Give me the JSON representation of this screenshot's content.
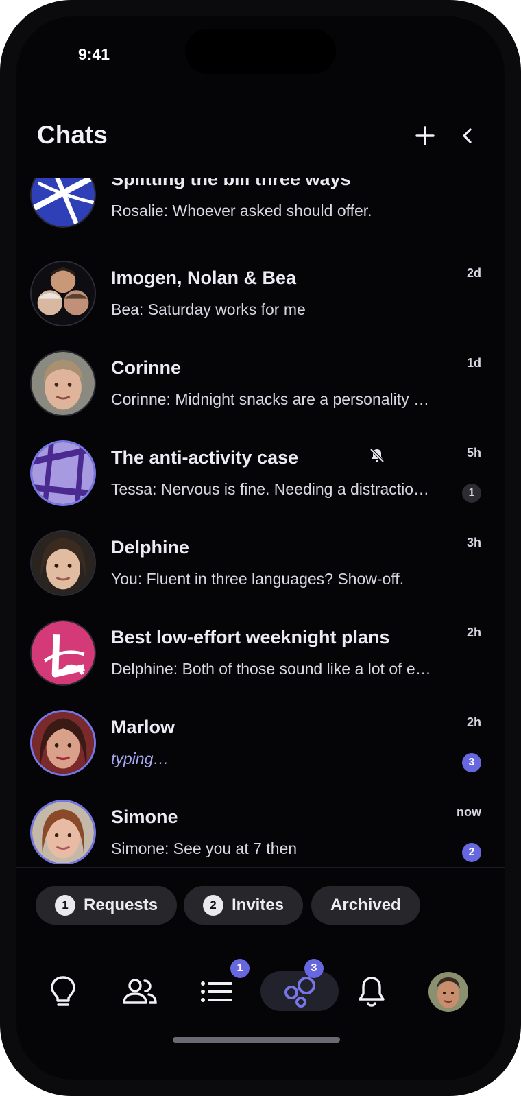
{
  "status": {
    "time": "9:41"
  },
  "header": {
    "title": "Chats"
  },
  "chats": [
    {
      "name": "Splitting the bill three ways",
      "message": "Rosalie: Whoever asked should offer.",
      "time": ""
    },
    {
      "name": "Imogen, Nolan & Bea",
      "message": "Bea: Saturday works for me",
      "time": "2d"
    },
    {
      "name": "Corinne",
      "message": "Corinne: Midnight snacks are a personality trait",
      "time": "1d"
    },
    {
      "name": "The anti-activity case",
      "message": "Tessa: Nervous is fine. Needing a distraction is normal",
      "time": "5h",
      "muted": true,
      "unread": "1"
    },
    {
      "name": "Delphine",
      "message": "You: Fluent in three languages? Show-off.",
      "time": "3h"
    },
    {
      "name": "Best low-effort weeknight plans",
      "message": "Delphine: Both of those sound like a lot of effort",
      "time": "2h"
    },
    {
      "name": "Marlow",
      "message": "typing…",
      "time": "2h",
      "unread": "3"
    },
    {
      "name": "Simone",
      "message": "Simone: See you at 7 then",
      "time": "now",
      "unread": "2"
    }
  ],
  "filters": [
    {
      "count": "1",
      "label": "Requests"
    },
    {
      "count": "2",
      "label": "Invites"
    },
    {
      "label": "Archived"
    }
  ],
  "tabbar": {
    "items": [
      "lightbulb-icon",
      "people-icon",
      "list-icon",
      "bubbles-icon",
      "bell-icon",
      "profile-avatar"
    ],
    "list_badge": "1",
    "bubbles_badge": "3",
    "active": "bubbles-icon"
  },
  "colors": {
    "accent": "#6767e0",
    "background": "#050508"
  }
}
